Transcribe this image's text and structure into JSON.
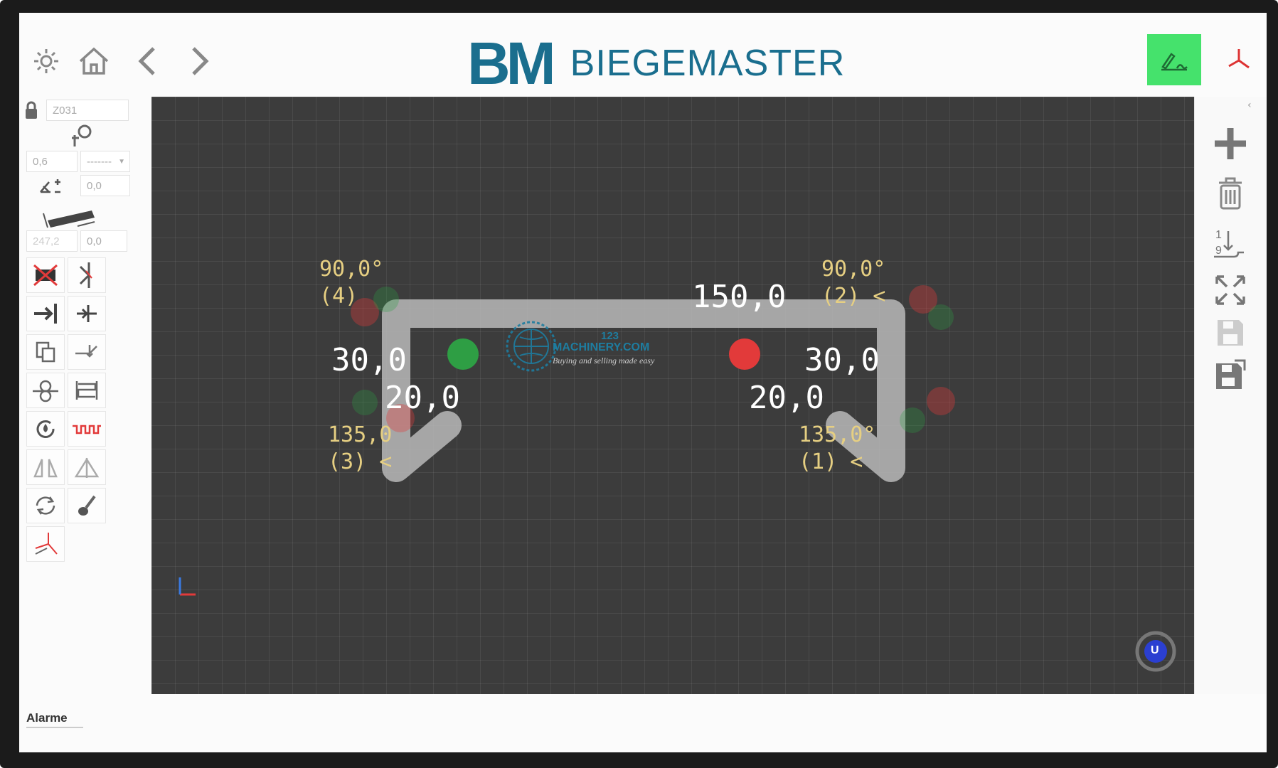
{
  "header": {
    "logo_mark": "BM",
    "brand": "BIEGEMASTER"
  },
  "left_panel": {
    "part_id": "Z031",
    "thickness": "0,6",
    "line_style": "-------",
    "angle_offset": "0,0",
    "length": "247,2",
    "length_offset": "0,0"
  },
  "drawing": {
    "dims": {
      "top": "150,0",
      "left_side": "30,0",
      "right_side": "30,0",
      "left_lip": "20,0",
      "right_lip": "20,0"
    },
    "angles": {
      "top_left": "90,0°\n(4)",
      "top_right": "90,0°\n(2) <",
      "bottom_left": "135,0\n(3) <",
      "bottom_right": "135,0°\n(1) <"
    },
    "markers": {
      "green": "#2e9e44",
      "red": "#e23a3a"
    },
    "watermark": {
      "number": "123",
      "name": "MACHINERY.COM",
      "tagline": "Buying and selling made easy"
    },
    "corner_badge": "U"
  },
  "footer": {
    "alarm": "Alarme"
  },
  "colors": {
    "accent": "#1a6e8e",
    "edit_button": "#45e26c",
    "canvas": "#3c3c3c",
    "angle_text": "#e6cf82"
  }
}
